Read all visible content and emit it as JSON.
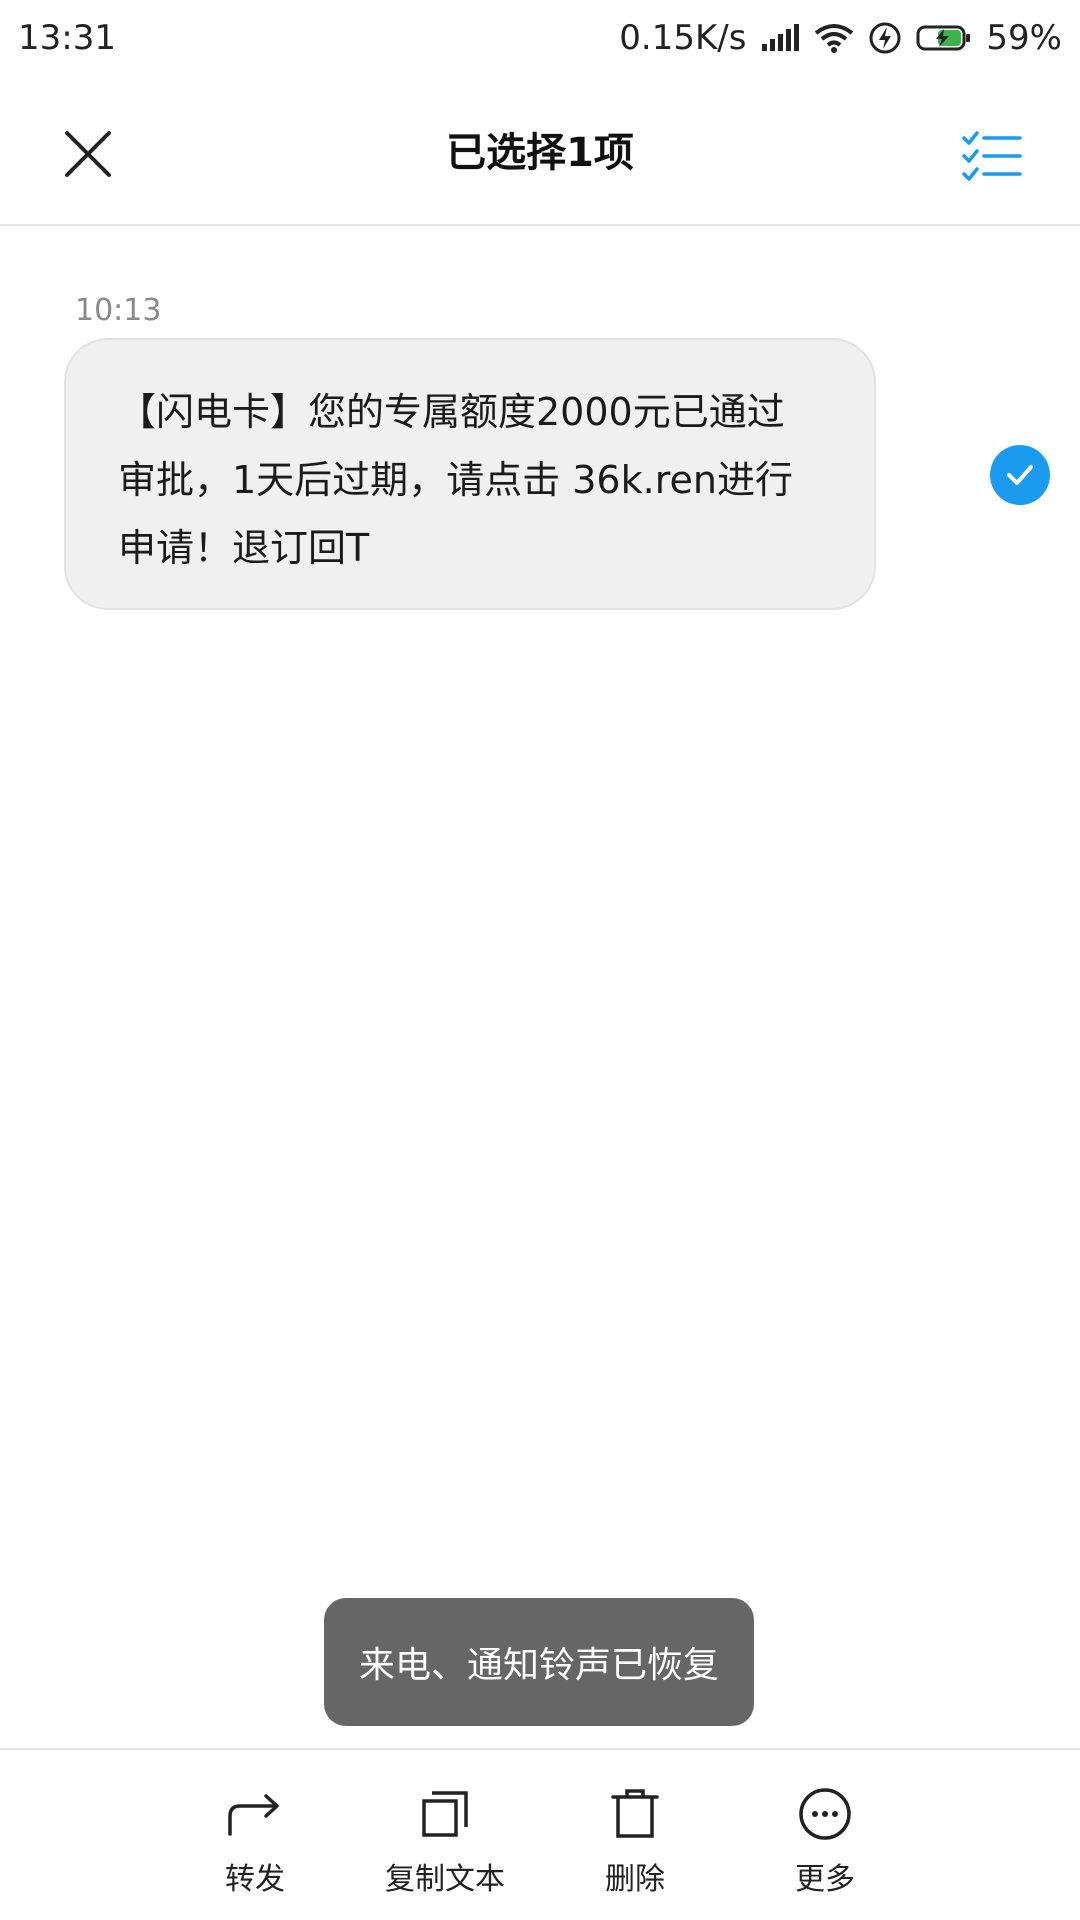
{
  "status_bar": {
    "time": "13:31",
    "network_speed": "0.15K/s",
    "battery": "59%",
    "icons": [
      "signal-icon",
      "wifi-icon",
      "flash-icon",
      "battery-charging-icon"
    ]
  },
  "header": {
    "title": "已选择1项",
    "close_icon": "close-icon",
    "select_all_icon": "checklist-icon",
    "accent": "#1a9bf0"
  },
  "message": {
    "time": "10:13",
    "text": "【闪电卡】您的专属额度2000元已通过审批，1天后过期，请点击  36k.ren进行申请！退订回T",
    "selected": true
  },
  "toast": {
    "text": "来电、通知铃声已恢复"
  },
  "toolbar": {
    "actions": [
      {
        "label": "转发",
        "icon": "forward-icon"
      },
      {
        "label": "复制文本",
        "icon": "copy-icon"
      },
      {
        "label": "删除",
        "icon": "delete-icon"
      },
      {
        "label": "更多",
        "icon": "more-icon"
      }
    ]
  }
}
